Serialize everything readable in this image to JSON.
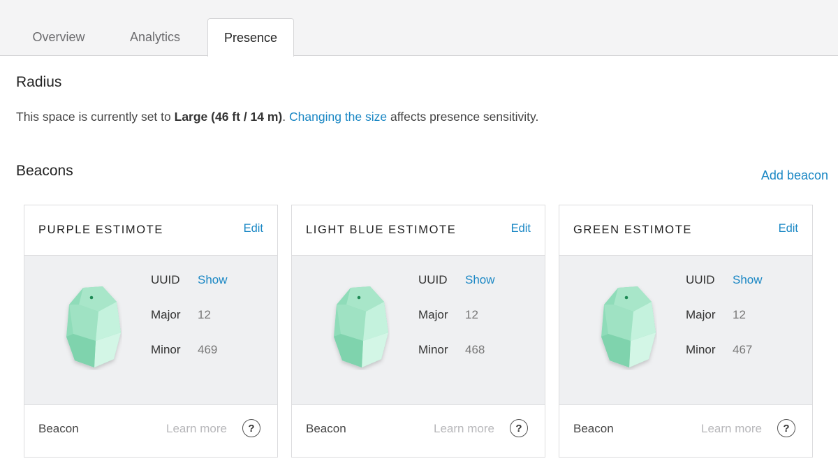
{
  "tabs": [
    {
      "label": "Overview",
      "active": false
    },
    {
      "label": "Analytics",
      "active": false
    },
    {
      "label": "Presence",
      "active": true
    }
  ],
  "radius": {
    "title": "Radius",
    "text_prefix": "This space is currently set to ",
    "size": "Large (46 ft / 14 m)",
    "text_mid": ". ",
    "link": "Changing the size",
    "text_suffix": " affects presence sensitivity."
  },
  "beacons": {
    "title": "Beacons",
    "add_label": "Add beacon",
    "items": [
      {
        "name": "PURPLE ESTIMOTE",
        "edit": "Edit",
        "uuid_label": "UUID",
        "uuid_value": "Show",
        "major_label": "Major",
        "major_value": "12",
        "minor_label": "Minor",
        "minor_value": "469",
        "type": "Beacon",
        "learn_more": "Learn more",
        "help": "?"
      },
      {
        "name": "LIGHT BLUE ESTIMOTE",
        "edit": "Edit",
        "uuid_label": "UUID",
        "uuid_value": "Show",
        "major_label": "Major",
        "major_value": "12",
        "minor_label": "Minor",
        "minor_value": "468",
        "type": "Beacon",
        "learn_more": "Learn more",
        "help": "?"
      },
      {
        "name": "GREEN ESTIMOTE",
        "edit": "Edit",
        "uuid_label": "UUID",
        "uuid_value": "Show",
        "major_label": "Major",
        "major_value": "12",
        "minor_label": "Minor",
        "minor_value": "467",
        "type": "Beacon",
        "learn_more": "Learn more",
        "help": "?"
      }
    ]
  },
  "colors": {
    "accent": "#1a87c4",
    "beacon_light": "#bdeed8",
    "beacon_mid": "#8fdcb9",
    "beacon_dark": "#6cc99f"
  }
}
